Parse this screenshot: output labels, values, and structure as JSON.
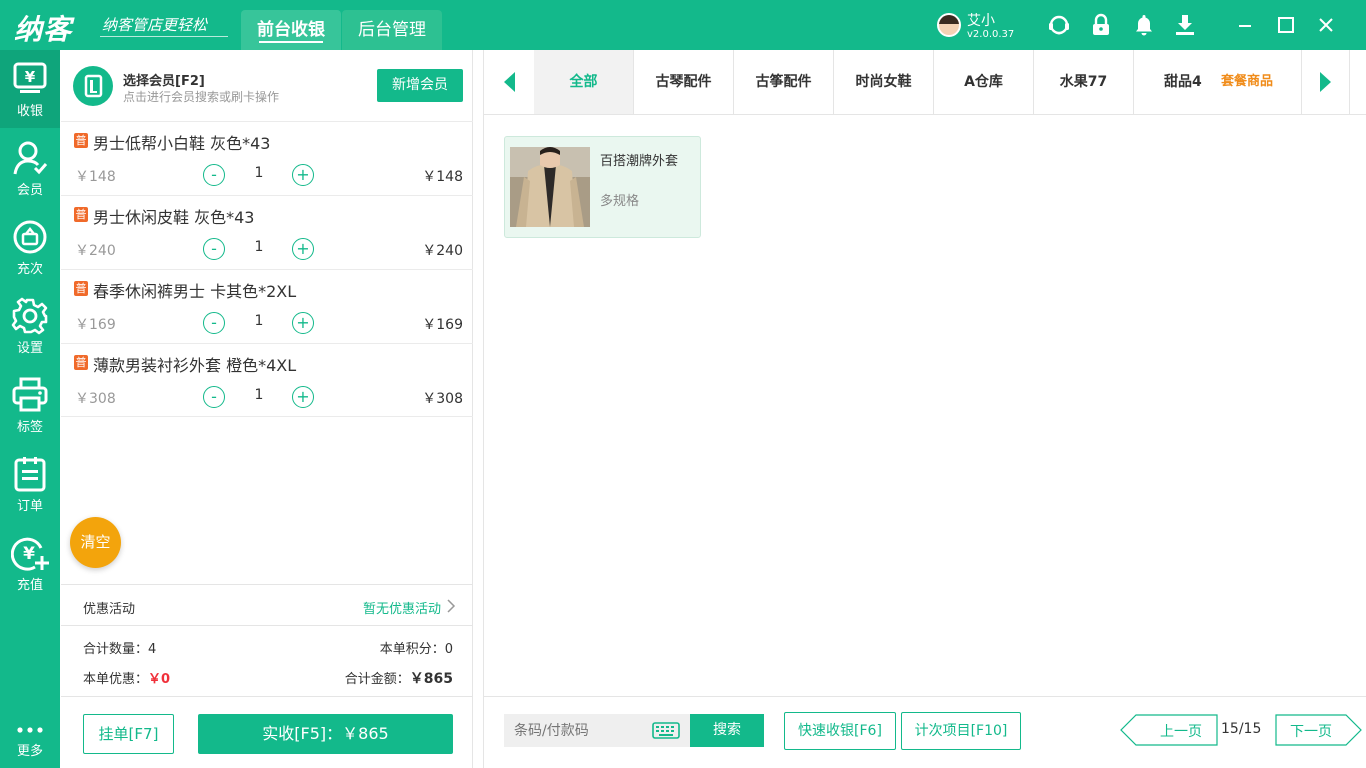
{
  "brand": {
    "logo": "纳客",
    "slogan": "纳客管店更轻松"
  },
  "top_tabs": [
    {
      "label": "前台收银"
    },
    {
      "label": "后台管理"
    }
  ],
  "user": {
    "name": "艾小",
    "version": "v2.0.0.37"
  },
  "sidebar": {
    "items": [
      {
        "label": "收银",
        "icon": "cashier-icon"
      },
      {
        "label": "会员",
        "icon": "member-icon"
      },
      {
        "label": "充次",
        "icon": "recharge-times-icon"
      },
      {
        "label": "设置",
        "icon": "gear-icon"
      },
      {
        "label": "标签",
        "icon": "printer-icon"
      },
      {
        "label": "订单",
        "icon": "order-icon"
      },
      {
        "label": "充值",
        "icon": "recharge-icon"
      },
      {
        "label": "更多",
        "icon": "more-icon"
      }
    ]
  },
  "member": {
    "title": "选择会员[F2]",
    "subtitle": "点击进行会员搜索或刷卡操作",
    "add_button": "新增会员"
  },
  "cart": {
    "items": [
      {
        "tag": "普",
        "name": "男士低帮小白鞋 灰色*43",
        "price": "￥148",
        "qty": "1",
        "subtotal": "￥148"
      },
      {
        "tag": "普",
        "name": "男士休闲皮鞋 灰色*43",
        "price": "￥240",
        "qty": "1",
        "subtotal": "￥240"
      },
      {
        "tag": "普",
        "name": "春季休闲裤男士 卡其色*2XL",
        "price": "￥169",
        "qty": "1",
        "subtotal": "￥169"
      },
      {
        "tag": "普",
        "name": "薄款男装衬衫外套 橙色*4XL",
        "price": "￥308",
        "qty": "1",
        "subtotal": "￥308"
      }
    ],
    "minus": "-",
    "plus": "+",
    "clear_button": "清空"
  },
  "promo": {
    "label": "优惠活动",
    "value": "暂无优惠活动"
  },
  "summary": {
    "count_label": "合计数量：",
    "count_value": "4",
    "points_label": "本单积分：",
    "points_value": "0",
    "discount_label": "本单优惠：",
    "discount_value": "￥0",
    "total_label": "合计金额：",
    "total_value": "￥865"
  },
  "actions": {
    "hang": "挂单[F7]",
    "pay": "实收[F5]：￥865"
  },
  "categories": {
    "items": [
      "全部",
      "古琴配件",
      "古筝配件",
      "时尚女鞋",
      "A仓库",
      "水果77",
      "甜品4"
    ],
    "combo": "套餐商品",
    "active_index": 0
  },
  "products": [
    {
      "name": "百搭潮牌外套",
      "spec": "多规格"
    }
  ],
  "bottom": {
    "barcode_placeholder": "条码/付款码",
    "search": "搜索",
    "quick_cashier": "快速收银[F6]",
    "count_items": "计次项目[F10]",
    "prev": "上一页",
    "page": "15/15",
    "next": "下一页"
  },
  "colors": {
    "accent": "#13b98b",
    "orange": "#f3a40c",
    "red": "#f0303a",
    "tag": "#f06a2a"
  }
}
